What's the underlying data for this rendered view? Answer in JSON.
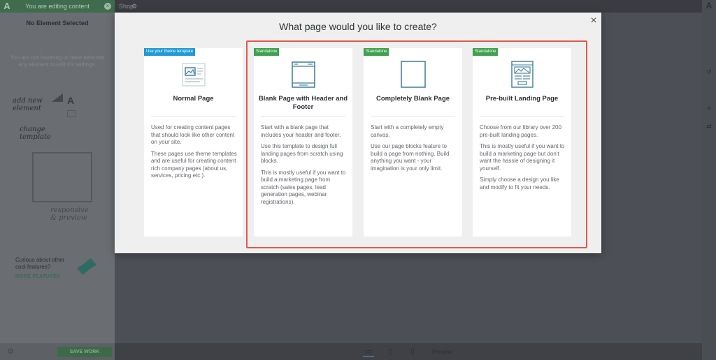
{
  "editor": {
    "top_message": "You are editing content",
    "panel_heading": "No Element Selected",
    "panel_hint": "You are not hovering or have selected any element to edit it's settings.",
    "doodle_add": "add new element",
    "doodle_change": "change template",
    "doodle_responsive": "responsive & preview",
    "curious": "Curious about other cool features?",
    "more_features": "MORE FEATURES",
    "save_button": "SAVE WORK",
    "page_name": "Shop",
    "preview_label": "Preview"
  },
  "modal": {
    "title": "What page would you like to create?",
    "close_glyph": "×",
    "cards": [
      {
        "badge": "Use your theme template",
        "badge_color": "#1f9bd7",
        "title": "Normal Page",
        "paragraphs": [
          "Used for creating content pages that should look like other content on your site.",
          "These pages use theme templates and are useful for creating content rich company pages (about us, services, pricing etc.)."
        ]
      },
      {
        "badge": "Standalone",
        "badge_color": "#3fa14e",
        "title": "Blank Page with Header and Footer",
        "paragraphs": [
          "Start with a blank page that includes your header and footer.",
          "Use this template to design full landing pages from scratch using blocks.",
          "This is mostly useful if you want to build a marketing page from scratch (sales pages, lead generation pages, webinar registrations)."
        ]
      },
      {
        "badge": "Standalone",
        "badge_color": "#3fa14e",
        "title": "Completely Blank Page",
        "paragraphs": [
          "Start with a completely empty canvas.",
          "Use our page blocks feature to build a page from nothing. Build anything you want - your imagination is your only limit."
        ]
      },
      {
        "badge": "Standalone",
        "badge_color": "#3fa14e",
        "title": "Pre-built Landing Page",
        "paragraphs": [
          "Choose from our library over 200 pre-built landing pages.",
          "This is mostly useful if you want to build a marketing page but don't want the hassle of designing it yourself.",
          "Simply choose a design you like and modify to fit your needs."
        ]
      }
    ]
  },
  "colors": {
    "highlight": "#e2584c",
    "icon_stroke": "#3d7c98"
  }
}
